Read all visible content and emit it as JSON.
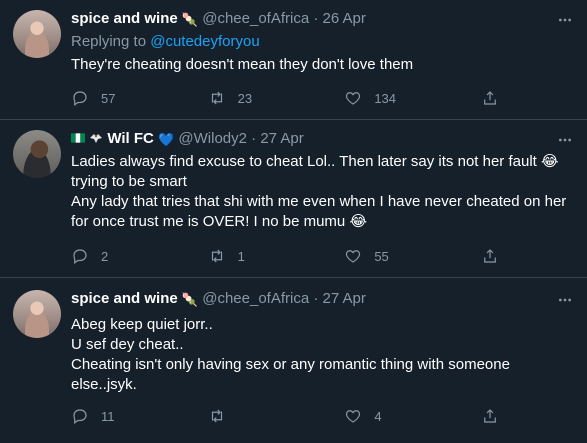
{
  "tweets": [
    {
      "name": "spice and wine",
      "name_emoji": "🍡",
      "handle": "@chee_ofAfrica",
      "dot": "·",
      "date": "26 Apr",
      "replying_prefix": "Replying to ",
      "replying_to": "@cutedeyforyou",
      "lines": [
        "They're cheating doesn't mean they don't love them"
      ],
      "replies": "57",
      "retweets": "23",
      "likes": "134"
    },
    {
      "name": "Wil FC",
      "name_emoji": "💙",
      "handle": "@Wilody2",
      "dot": "·",
      "date": "27 Apr",
      "lines": [
        "Ladies always find excuse to cheat Lol.. Then later say its not her fault 😂",
        "trying to be smart",
        "Any lady that tries that shi with me even when I have never cheated on her",
        "for once trust me is OVER! I no be mumu 😂"
      ],
      "replies": "2",
      "retweets": "1",
      "likes": "55"
    },
    {
      "name": "spice and wine",
      "name_emoji": "🍡",
      "handle": "@chee_ofAfrica",
      "dot": "·",
      "date": "27 Apr",
      "lines": [
        "Abeg keep quiet jorr..",
        "U sef dey cheat..",
        "Cheating isn't only having sex or any romantic thing  with someone",
        "else..jsyk."
      ],
      "replies": "11",
      "retweets": "",
      "likes": "4"
    }
  ],
  "icons": {
    "reply": "reply-icon",
    "retweet": "retweet-icon",
    "like": "heart-icon",
    "share": "share-icon",
    "more": "more-icon",
    "flag": "nigeria-flag-icon",
    "eagle": "eagle-icon"
  },
  "colors": {
    "background": "#15202b",
    "secondary_text": "#8899a6",
    "link": "#1da1f2",
    "divider": "#38444d",
    "heart_emoji": "#1d9bf0"
  }
}
